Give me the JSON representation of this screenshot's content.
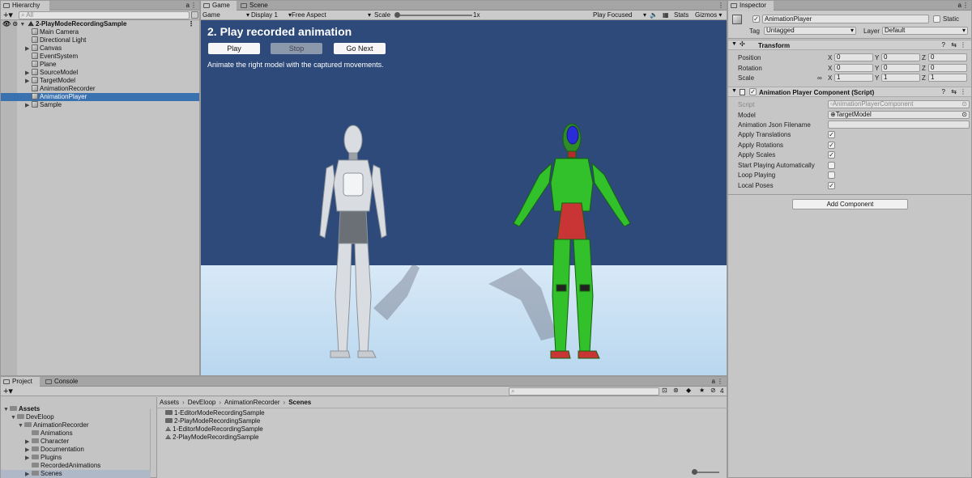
{
  "hierarchy": {
    "tab": "Hierarchy",
    "search_placeholder": "All",
    "scene": "2-PlayModeRecordingSample",
    "items": [
      {
        "label": "Main Camera",
        "expand": ""
      },
      {
        "label": "Directional Light",
        "expand": ""
      },
      {
        "label": "Canvas",
        "expand": "▶"
      },
      {
        "label": "EventSystem",
        "expand": ""
      },
      {
        "label": "Plane",
        "expand": ""
      },
      {
        "label": "SourceModel",
        "expand": "▶"
      },
      {
        "label": "TargetModel",
        "expand": "▶"
      },
      {
        "label": "AnimationRecorder",
        "expand": ""
      },
      {
        "label": "AnimationPlayer",
        "expand": "",
        "selected": true
      },
      {
        "label": "Sample",
        "expand": "▶"
      }
    ]
  },
  "game": {
    "tabs": {
      "game": "Game",
      "scene": "Scene"
    },
    "toolbar": {
      "mode": "Game",
      "display": "Display 1",
      "aspect": "Free Aspect",
      "scale_label": "Scale",
      "scale_value": "1x",
      "play_focused": "Play Focused",
      "stats": "Stats",
      "gizmos": "Gizmos"
    },
    "heading": "2. Play recorded animation",
    "buttons": {
      "play": "Play",
      "stop": "Stop",
      "next": "Go Next"
    },
    "subtitle": "Animate the right model with the captured movements.",
    "colors": {
      "sky": "#2d4a7a",
      "floor": "#d6e6f4",
      "accent_btn": "#8c99ad"
    }
  },
  "inspector": {
    "tab": "Inspector",
    "object_name": "AnimationPlayer",
    "static_label": "Static",
    "tag_label": "Tag",
    "tag_value": "Untagged",
    "layer_label": "Layer",
    "layer_value": "Default",
    "transform": {
      "title": "Transform",
      "rows": [
        {
          "label": "Position",
          "x": "0",
          "y": "0",
          "z": "0"
        },
        {
          "label": "Rotation",
          "x": "0",
          "y": "0",
          "z": "0"
        },
        {
          "label": "Scale",
          "x": "1",
          "y": "1",
          "z": "1"
        }
      ]
    },
    "component": {
      "title": "Animation Player Component (Script)",
      "script_label": "Script",
      "script_value": "AnimationPlayerComponent",
      "model_label": "Model",
      "model_value": "TargetModel",
      "json_label": "Animation Json Filename",
      "json_value": "",
      "toggles": [
        {
          "label": "Apply Translations",
          "checked": true
        },
        {
          "label": "Apply Rotations",
          "checked": true
        },
        {
          "label": "Apply Scales",
          "checked": true
        },
        {
          "label": "Start Playing Automatically",
          "checked": false
        },
        {
          "label": "Loop Playing",
          "checked": false
        },
        {
          "label": "Local Poses",
          "checked": true
        }
      ]
    },
    "add_component": "Add Component"
  },
  "project": {
    "tabs": {
      "project": "Project",
      "console": "Console"
    },
    "badge": "4",
    "tree": [
      {
        "label": "Assets",
        "depth": 0,
        "expand": "▼",
        "bold": true
      },
      {
        "label": "DevEloop",
        "depth": 1,
        "expand": "▼"
      },
      {
        "label": "AnimationRecorder",
        "depth": 2,
        "expand": "▼"
      },
      {
        "label": "Animations",
        "depth": 3,
        "expand": ""
      },
      {
        "label": "Character",
        "depth": 3,
        "expand": "▶"
      },
      {
        "label": "Documentation",
        "depth": 3,
        "expand": "▶"
      },
      {
        "label": "Plugins",
        "depth": 3,
        "expand": "▶"
      },
      {
        "label": "RecordedAnimations",
        "depth": 3,
        "expand": ""
      },
      {
        "label": "Scenes",
        "depth": 3,
        "expand": "▶",
        "selected": true
      }
    ],
    "breadcrumb": [
      "Assets",
      "DevEloop",
      "AnimationRecorder",
      "Scenes"
    ],
    "files": [
      {
        "label": "1-EditorModeRecordingSample",
        "icon": "folder"
      },
      {
        "label": "2-PlayModeRecordingSample",
        "icon": "folder"
      },
      {
        "label": "1-EditorModeRecordingSample",
        "icon": "scene"
      },
      {
        "label": "2-PlayModeRecordingSample",
        "icon": "scene"
      }
    ]
  }
}
